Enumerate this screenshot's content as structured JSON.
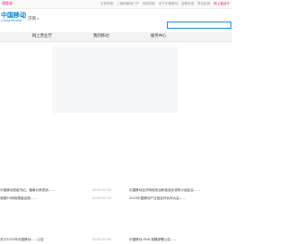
{
  "topbar": {
    "left_link": "请登录",
    "links": [
      "手机导航",
      "二维码移动门户",
      "网站导航",
      "关于中国移动",
      "证照信息",
      "意见反馈"
    ],
    "hot_link": "网上营业厅"
  },
  "header": {
    "logo_cn": "中国移动",
    "logo_en": "China Mobile",
    "city": "济南",
    "search_placeholder": ""
  },
  "nav": {
    "items": [
      "网上营业厅",
      "我的移动",
      "服务中心"
    ]
  },
  "news": {
    "rows": [
      {
        "title": "中国移动党组书记、董事长杨杰到……",
        "date": "2023-07-24",
        "title2": "中国移动召开网络安全和信息化领导小组会议……"
      },
      {
        "title": "我国5G网络覆盖全国……",
        "date": "2023-07-13",
        "title2": "2023中国移动产业链合作伙伴大会……"
      },
      {
        "title": "关于2023年中国移动……公告",
        "date": "2023-07-06",
        "title2": "中国移动 IPv6 规模部署公告……"
      }
    ]
  },
  "colors": {
    "brand": "#0085d0",
    "accent": "#e0006c"
  }
}
